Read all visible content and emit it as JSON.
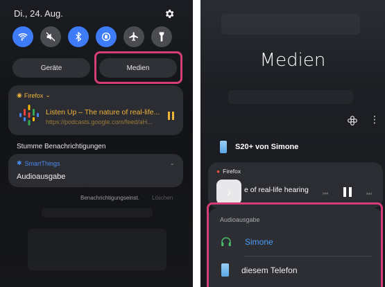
{
  "left": {
    "date": "Di., 24. Aug.",
    "tabs": {
      "devices": "Geräte",
      "media": "Medien"
    },
    "media_card": {
      "source": "Firefox",
      "title": "Listen Up – The nature of real-life...",
      "url": "https://podcasts.google.com/feed/aH..."
    },
    "silent_label": "Stumme Benachrichtigungen",
    "smartthings": {
      "source": "SmartThings",
      "title": "Audioausgabe"
    },
    "footer": {
      "settings": "Benachrichtigungseinst.",
      "clear": "Löschen"
    }
  },
  "right": {
    "title": "Medien",
    "device": "S20+ von Simone",
    "card": {
      "source": "Firefox",
      "track": "e of real-life hearing"
    },
    "audio_output": {
      "label": "Audioausgabe",
      "options": [
        "Simone",
        "diesem Telefon"
      ]
    }
  },
  "colors": {
    "accent_blue": "#3d7cf6",
    "highlight": "#d63d78",
    "firefox_orange": "#f0b43a"
  },
  "icons": [
    "wifi-icon",
    "mute-icon",
    "bluetooth-icon",
    "auto-rotate-icon",
    "airplane-icon",
    "flashlight-icon",
    "gear-icon",
    "pause-icon"
  ]
}
